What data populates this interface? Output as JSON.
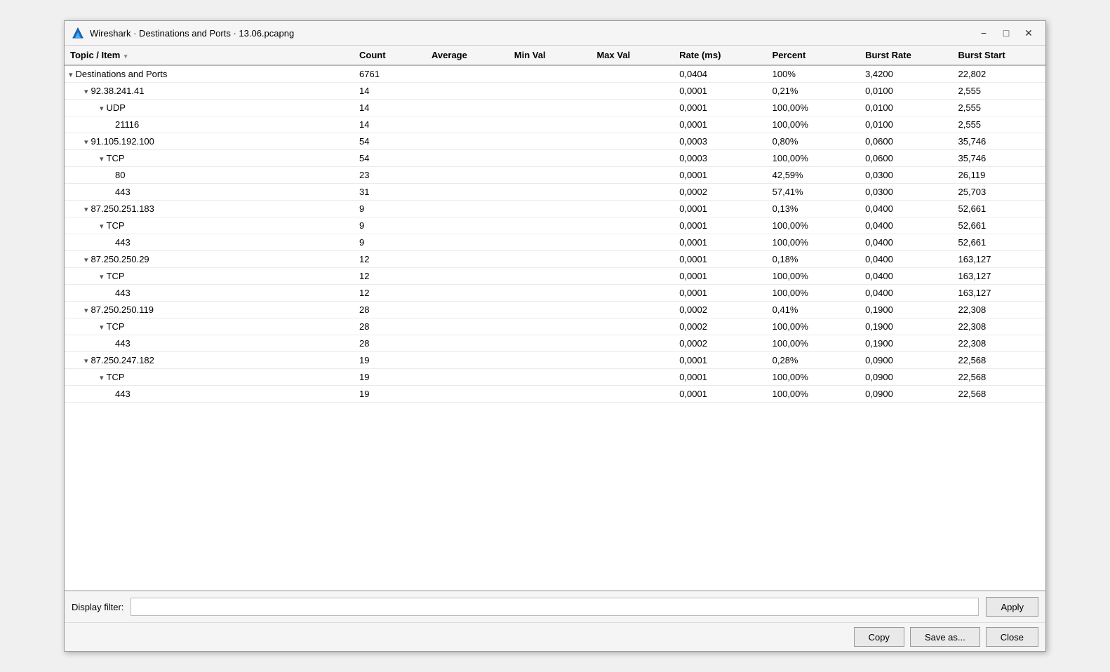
{
  "window": {
    "title": "Wireshark · Destinations and Ports · 13.06.pcapng",
    "min_label": "−",
    "max_label": "□",
    "close_label": "✕"
  },
  "table": {
    "columns": [
      {
        "id": "topic",
        "label": "Topic / Item",
        "sort": "desc"
      },
      {
        "id": "count",
        "label": "Count"
      },
      {
        "id": "avg",
        "label": "Average"
      },
      {
        "id": "minval",
        "label": "Min Val"
      },
      {
        "id": "maxval",
        "label": "Max Val"
      },
      {
        "id": "rate",
        "label": "Rate (ms)"
      },
      {
        "id": "pct",
        "label": "Percent"
      },
      {
        "id": "burst",
        "label": "Burst Rate"
      },
      {
        "id": "bstart",
        "label": "Burst Start"
      }
    ],
    "rows": [
      {
        "indent": 0,
        "chevron": "▾",
        "label": "Destinations and Ports",
        "count": "6761",
        "avg": "",
        "minval": "",
        "maxval": "",
        "rate": "0,0404",
        "pct": "100%",
        "burst": "3,4200",
        "bstart": "22,802"
      },
      {
        "indent": 1,
        "chevron": "▾",
        "label": "92.38.241.41",
        "count": "14",
        "avg": "",
        "minval": "",
        "maxval": "",
        "rate": "0,0001",
        "pct": "0,21%",
        "burst": "0,0100",
        "bstart": "2,555"
      },
      {
        "indent": 2,
        "chevron": "▾",
        "label": "UDP",
        "count": "14",
        "avg": "",
        "minval": "",
        "maxval": "",
        "rate": "0,0001",
        "pct": "100,00%",
        "burst": "0,0100",
        "bstart": "2,555"
      },
      {
        "indent": 3,
        "chevron": "",
        "label": "21116",
        "count": "14",
        "avg": "",
        "minval": "",
        "maxval": "",
        "rate": "0,0001",
        "pct": "100,00%",
        "burst": "0,0100",
        "bstart": "2,555"
      },
      {
        "indent": 1,
        "chevron": "▾",
        "label": "91.105.192.100",
        "count": "54",
        "avg": "",
        "minval": "",
        "maxval": "",
        "rate": "0,0003",
        "pct": "0,80%",
        "burst": "0,0600",
        "bstart": "35,746"
      },
      {
        "indent": 2,
        "chevron": "▾",
        "label": "TCP",
        "count": "54",
        "avg": "",
        "minval": "",
        "maxval": "",
        "rate": "0,0003",
        "pct": "100,00%",
        "burst": "0,0600",
        "bstart": "35,746"
      },
      {
        "indent": 3,
        "chevron": "",
        "label": "80",
        "count": "23",
        "avg": "",
        "minval": "",
        "maxval": "",
        "rate": "0,0001",
        "pct": "42,59%",
        "burst": "0,0300",
        "bstart": "26,119"
      },
      {
        "indent": 3,
        "chevron": "",
        "label": "443",
        "count": "31",
        "avg": "",
        "minval": "",
        "maxval": "",
        "rate": "0,0002",
        "pct": "57,41%",
        "burst": "0,0300",
        "bstart": "25,703"
      },
      {
        "indent": 1,
        "chevron": "▾",
        "label": "87.250.251.183",
        "count": "9",
        "avg": "",
        "minval": "",
        "maxval": "",
        "rate": "0,0001",
        "pct": "0,13%",
        "burst": "0,0400",
        "bstart": "52,661"
      },
      {
        "indent": 2,
        "chevron": "▾",
        "label": "TCP",
        "count": "9",
        "avg": "",
        "minval": "",
        "maxval": "",
        "rate": "0,0001",
        "pct": "100,00%",
        "burst": "0,0400",
        "bstart": "52,661"
      },
      {
        "indent": 3,
        "chevron": "",
        "label": "443",
        "count": "9",
        "avg": "",
        "minval": "",
        "maxval": "",
        "rate": "0,0001",
        "pct": "100,00%",
        "burst": "0,0400",
        "bstart": "52,661"
      },
      {
        "indent": 1,
        "chevron": "▾",
        "label": "87.250.250.29",
        "count": "12",
        "avg": "",
        "minval": "",
        "maxval": "",
        "rate": "0,0001",
        "pct": "0,18%",
        "burst": "0,0400",
        "bstart": "163,127"
      },
      {
        "indent": 2,
        "chevron": "▾",
        "label": "TCP",
        "count": "12",
        "avg": "",
        "minval": "",
        "maxval": "",
        "rate": "0,0001",
        "pct": "100,00%",
        "burst": "0,0400",
        "bstart": "163,127"
      },
      {
        "indent": 3,
        "chevron": "",
        "label": "443",
        "count": "12",
        "avg": "",
        "minval": "",
        "maxval": "",
        "rate": "0,0001",
        "pct": "100,00%",
        "burst": "0,0400",
        "bstart": "163,127"
      },
      {
        "indent": 1,
        "chevron": "▾",
        "label": "87.250.250.119",
        "count": "28",
        "avg": "",
        "minval": "",
        "maxval": "",
        "rate": "0,0002",
        "pct": "0,41%",
        "burst": "0,1900",
        "bstart": "22,308"
      },
      {
        "indent": 2,
        "chevron": "▾",
        "label": "TCP",
        "count": "28",
        "avg": "",
        "minval": "",
        "maxval": "",
        "rate": "0,0002",
        "pct": "100,00%",
        "burst": "0,1900",
        "bstart": "22,308"
      },
      {
        "indent": 3,
        "chevron": "",
        "label": "443",
        "count": "28",
        "avg": "",
        "minval": "",
        "maxval": "",
        "rate": "0,0002",
        "pct": "100,00%",
        "burst": "0,1900",
        "bstart": "22,308"
      },
      {
        "indent": 1,
        "chevron": "▾",
        "label": "87.250.247.182",
        "count": "19",
        "avg": "",
        "minval": "",
        "maxval": "",
        "rate": "0,0001",
        "pct": "0,28%",
        "burst": "0,0900",
        "bstart": "22,568"
      },
      {
        "indent": 2,
        "chevron": "▾",
        "label": "TCP",
        "count": "19",
        "avg": "",
        "minval": "",
        "maxval": "",
        "rate": "0,0001",
        "pct": "100,00%",
        "burst": "0,0900",
        "bstart": "22,568"
      },
      {
        "indent": 3,
        "chevron": "",
        "label": "443",
        "count": "19",
        "avg": "",
        "minval": "",
        "maxval": "",
        "rate": "0,0001",
        "pct": "100,00%",
        "burst": "0,0900",
        "bstart": "22,568"
      }
    ]
  },
  "filter_bar": {
    "label": "Display filter:",
    "placeholder": "",
    "value": "",
    "apply_label": "Apply"
  },
  "bottom_bar": {
    "copy_label": "Copy",
    "save_label": "Save as...",
    "close_label": "Close"
  }
}
